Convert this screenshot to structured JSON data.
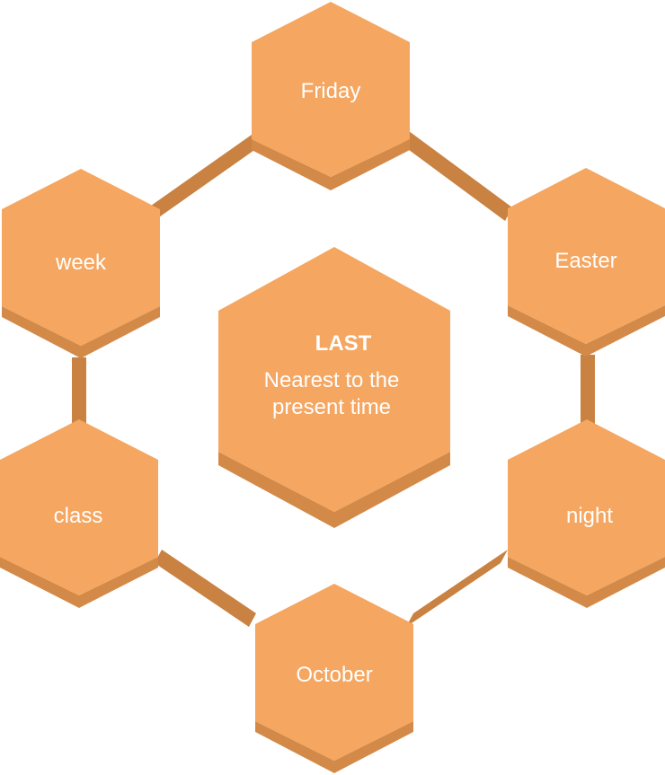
{
  "center": {
    "title": "LAST",
    "description_line1": "Nearest to the",
    "description_line2": "present time"
  },
  "words": {
    "top": "Friday",
    "upper_right": "Easter",
    "lower_right": "night",
    "bottom": "October",
    "lower_left": "class",
    "upper_left": "week"
  },
  "colors": {
    "hex_face": "#F5A660",
    "hex_side": "#D38A49",
    "connector": "#C98242",
    "text": "#FFFFFF"
  }
}
